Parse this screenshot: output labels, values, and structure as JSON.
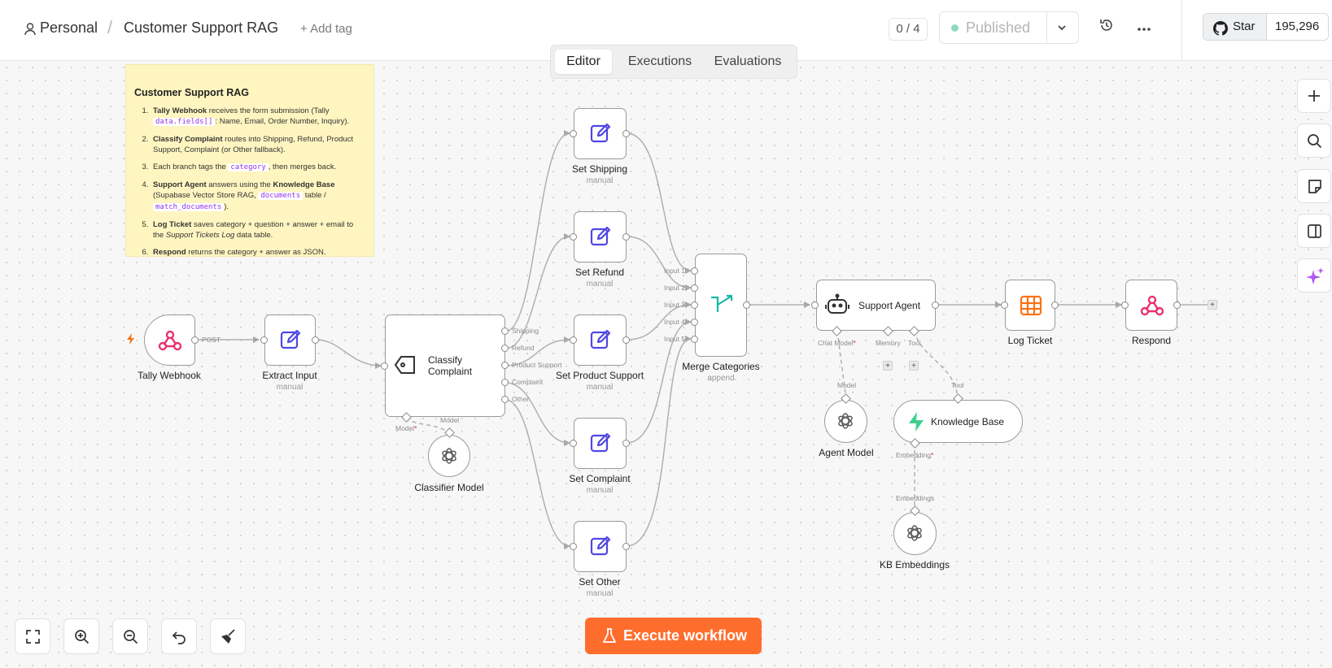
{
  "header": {
    "project": "Personal",
    "separator": "/",
    "workflow_name": "Customer Support RAG",
    "add_tag": "+ Add tag",
    "step_count": "0 / 4",
    "publish_label": "Published",
    "github_star": "Star",
    "github_count": "195,296"
  },
  "tabs": [
    {
      "label": "Editor",
      "active": true
    },
    {
      "label": "Executions",
      "active": false
    },
    {
      "label": "Evaluations",
      "active": false
    }
  ],
  "sticky": {
    "title": "Customer Support RAG",
    "items": [
      {
        "b1": "Tally Webhook",
        "t1": " receives the form submission (Tally ",
        "code1": "data.fields[]",
        "t2": ": Name, Email, Order Number, Inquiry)."
      },
      {
        "b1": "Classify Complaint",
        "t1": " routes into Shipping, Refund, Product Support, Complaint (or Other fallback)."
      },
      {
        "t1": "Each branch tags the ",
        "code1": "category",
        "t2": ", then merges back."
      },
      {
        "b1": "Support Agent",
        "t1": " answers using the ",
        "b2": "Knowledge Base",
        "t2": " (Supabase Vector Store RAG, ",
        "code1": "documents",
        "t3": " table / ",
        "code2": "match_documents",
        "t4": ")."
      },
      {
        "b1": "Log Ticket",
        "t1": " saves category + question + answer + email to the ",
        "i1": "Support Tickets Log",
        "t2": " data table."
      },
      {
        "b1": "Respond",
        "t1": " returns the category + answer as JSON."
      }
    ]
  },
  "nodes": {
    "tally_webhook": {
      "label": "Tally Webhook",
      "port_label": "POST"
    },
    "extract_input": {
      "label": "Extract Input",
      "sub": "manual"
    },
    "classify": {
      "label": "Classify Complaint",
      "ports": [
        "Shipping",
        "Refund",
        "Product Support",
        "Complaint",
        "Other"
      ],
      "model_port": "Model"
    },
    "classifier_model": {
      "label": "Classifier Model",
      "port_label": "Model"
    },
    "set_shipping": {
      "label": "Set Shipping",
      "sub": "manual"
    },
    "set_refund": {
      "label": "Set Refund",
      "sub": "manual"
    },
    "set_product_support": {
      "label": "Set Product Support",
      "sub": "manual"
    },
    "set_complaint": {
      "label": "Set Complaint",
      "sub": "manual"
    },
    "set_other": {
      "label": "Set Other",
      "sub": "manual"
    },
    "merge": {
      "label": "Merge Categories",
      "sub": "append",
      "inputs": [
        "Input 1",
        "Input 2",
        "Input 3",
        "Input 4",
        "Input 5"
      ]
    },
    "support_agent": {
      "label": "Support Agent",
      "chat_model": "Chat Model",
      "memory": "Memory",
      "tool": "Tool"
    },
    "agent_model": {
      "label": "Agent Model",
      "port_label": "Model"
    },
    "knowledge_base": {
      "label": "Knowledge Base",
      "tool_port": "Tool",
      "embedding": "Embedding"
    },
    "kb_embeddings": {
      "label": "KB Embeddings",
      "port_label": "Embeddings"
    },
    "log_ticket": {
      "label": "Log Ticket"
    },
    "respond": {
      "label": "Respond"
    }
  },
  "required_mark": "*",
  "plus": "+",
  "execute_label": "Execute workflow",
  "colors": {
    "accent": "#ff6d2d",
    "edit_icon": "#4f46e5",
    "webhook": "#e8336f",
    "table": "#f97316",
    "sticky": "#fff5c0"
  }
}
